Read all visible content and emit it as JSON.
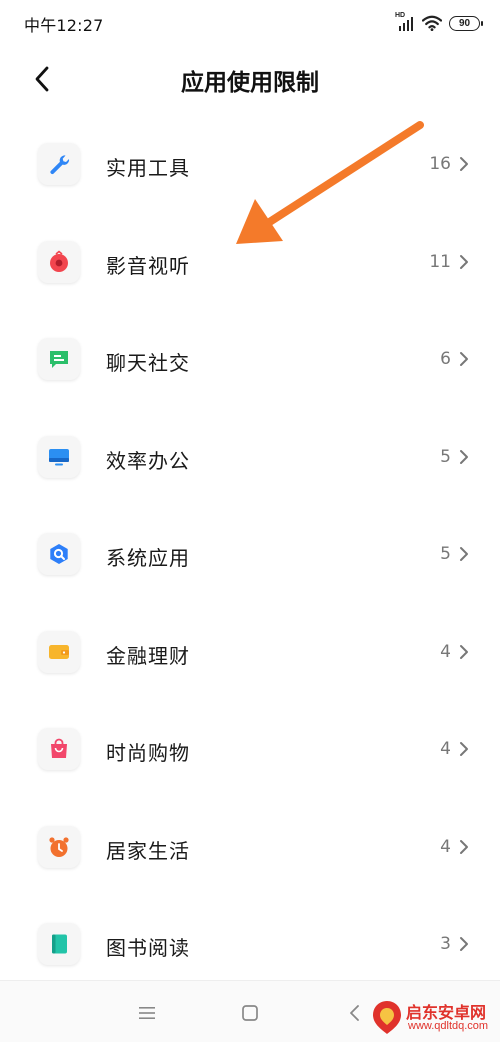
{
  "status_bar": {
    "time": "中午12:27",
    "network_label": "HD",
    "battery": "90"
  },
  "header": {
    "title": "应用使用限制",
    "back_icon": "chevron-left-icon"
  },
  "categories": [
    {
      "label": "实用工具",
      "count": "16",
      "icon": "wrench-icon",
      "color": "#2f86f6"
    },
    {
      "label": "影音视听",
      "count": "11",
      "icon": "media-icon",
      "color": "#f2454e"
    },
    {
      "label": "聊天社交",
      "count": "6",
      "icon": "chat-icon",
      "color": "#2bbf6a"
    },
    {
      "label": "效率办公",
      "count": "5",
      "icon": "monitor-icon",
      "color": "#2b8ff2"
    },
    {
      "label": "系统应用",
      "count": "5",
      "icon": "system-icon",
      "color": "#2d7ff9"
    },
    {
      "label": "金融理财",
      "count": "4",
      "icon": "wallet-icon",
      "color": "#f7b52c"
    },
    {
      "label": "时尚购物",
      "count": "4",
      "icon": "shopping-bag-icon",
      "color": "#f2476b"
    },
    {
      "label": "居家生活",
      "count": "4",
      "icon": "alarm-clock-icon",
      "color": "#f2712e"
    },
    {
      "label": "图书阅读",
      "count": "3",
      "icon": "book-icon",
      "color": "#22c4a8"
    }
  ],
  "annotation": {
    "arrow_color": "#f47a2a"
  },
  "nav_bar": {
    "menu_icon": "menu-icon",
    "home_icon": "home-square-icon",
    "back_icon": "back-triangle-icon"
  },
  "watermark": {
    "title": "启东安卓网",
    "url": "www.qdltdq.com",
    "color": "#e0322b"
  }
}
